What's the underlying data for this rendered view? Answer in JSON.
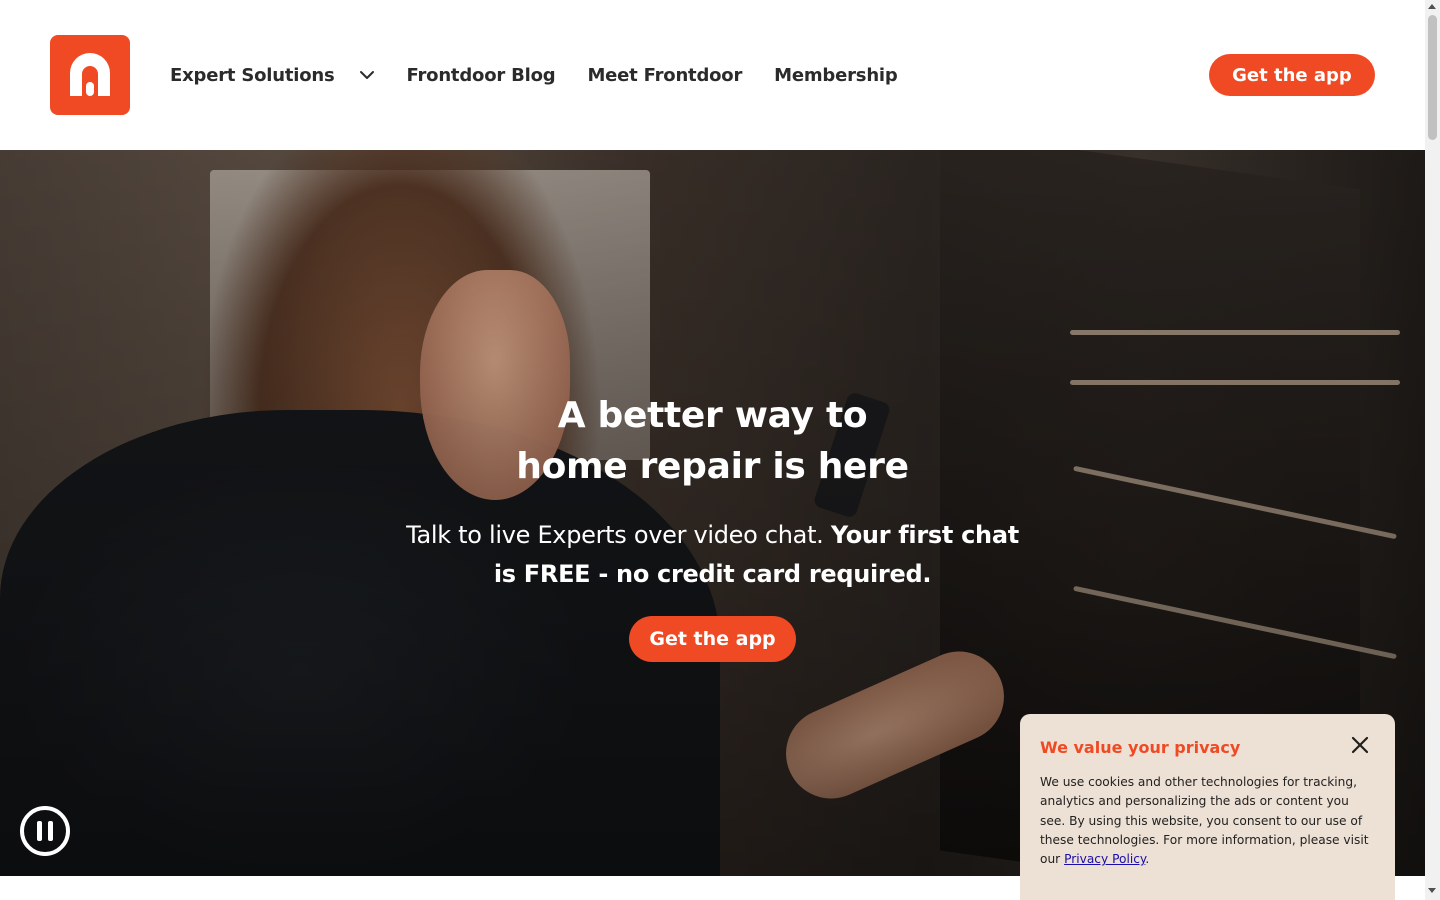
{
  "header": {
    "logo_icon": "frontdoor-arch-logo",
    "nav": {
      "expert_solutions": "Expert Solutions",
      "blog": "Frontdoor Blog",
      "meet": "Meet Frontdoor",
      "membership": "Membership"
    },
    "cta_label": "Get the app"
  },
  "hero": {
    "title_line1": "A better way to",
    "title_line2": "home repair is here",
    "subtitle_plain": "Talk to live Experts over video chat. ",
    "subtitle_bold": "Your first chat is FREE - no credit card required.",
    "cta_label": "Get the app",
    "pause_icon": "pause-icon"
  },
  "cookie": {
    "title": "We value your privacy",
    "body": "We use cookies and other technologies for tracking, analytics and personalizing the ads or content you see. By using this website, you consent to our use of these technologies. For more information, please visit our ",
    "link_label": "Privacy Policy",
    "body_end": "."
  },
  "colors": {
    "brand": "#ef4a23",
    "cookie_bg": "#ede0d4",
    "nav_text": "#2b2b2b"
  }
}
